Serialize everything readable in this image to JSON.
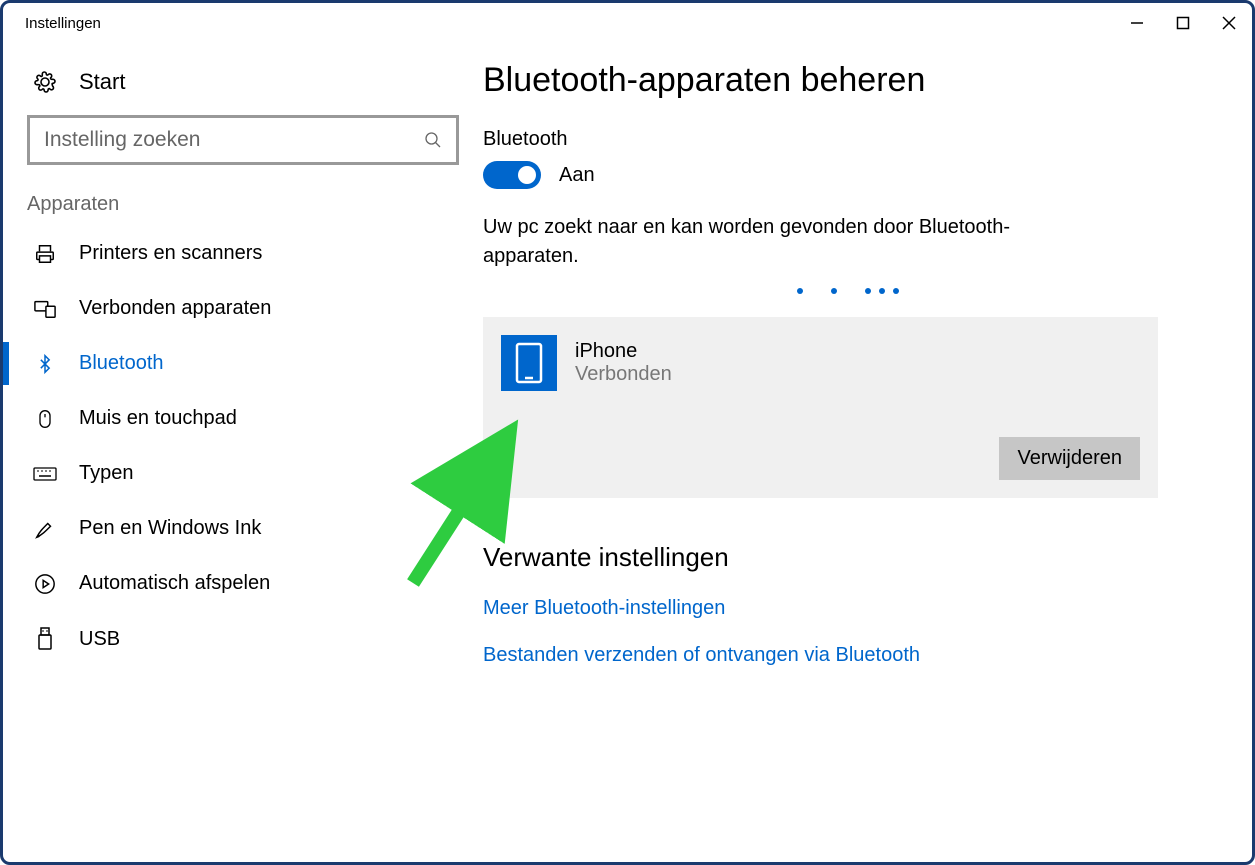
{
  "window": {
    "title": "Instellingen"
  },
  "sidebar": {
    "start_label": "Start",
    "search_placeholder": "Instelling zoeken",
    "section_label": "Apparaten",
    "items": [
      {
        "label": "Printers en scanners"
      },
      {
        "label": "Verbonden apparaten"
      },
      {
        "label": "Bluetooth"
      },
      {
        "label": "Muis en touchpad"
      },
      {
        "label": "Typen"
      },
      {
        "label": "Pen en Windows Ink"
      },
      {
        "label": "Automatisch afspelen"
      },
      {
        "label": "USB"
      }
    ]
  },
  "main": {
    "heading": "Bluetooth-apparaten beheren",
    "toggle_label": "Bluetooth",
    "toggle_state": "Aan",
    "discover_text": "Uw pc zoekt naar en kan worden gevonden door Bluetooth-apparaten.",
    "device": {
      "name": "iPhone",
      "status": "Verbonden",
      "remove_label": "Verwijderen"
    },
    "related_heading": "Verwante instellingen",
    "links": [
      {
        "label": "Meer Bluetooth-instellingen"
      },
      {
        "label": "Bestanden verzenden of ontvangen via Bluetooth"
      }
    ]
  }
}
